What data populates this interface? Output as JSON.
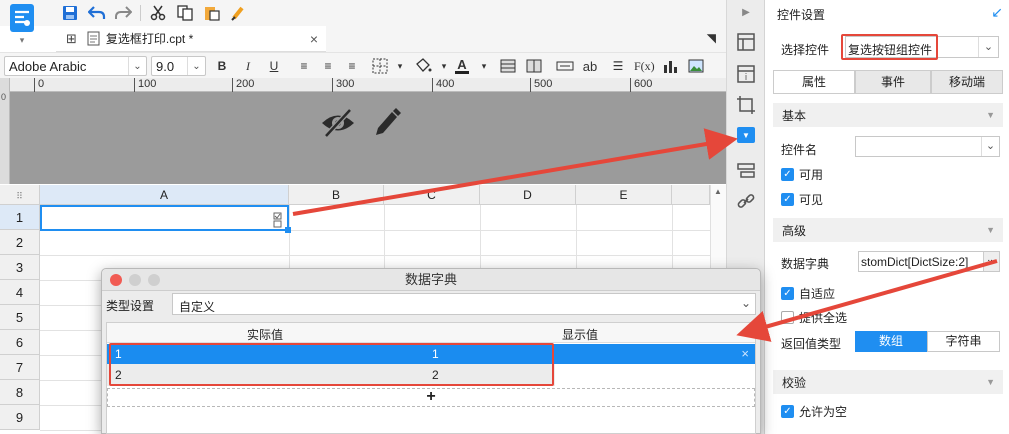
{
  "toolbar": {
    "icons": [
      "save-icon",
      "undo-icon",
      "redo-icon",
      "cut-icon",
      "copy-icon",
      "paste-icon",
      "format-painter-icon"
    ]
  },
  "tab": {
    "label": "复选框打印.cpt *",
    "close": "×"
  },
  "format": {
    "font_name": "Adobe Arabic",
    "font_size": "9.0",
    "bold": "B",
    "italic": "I",
    "underline": "U",
    "text_btn": "ab",
    "formula_btn": "F(x)"
  },
  "ruler": {
    "marks": [
      "0",
      "100",
      "200",
      "300",
      "400",
      "500",
      "600"
    ]
  },
  "grid": {
    "columns": [
      "A",
      "B",
      "C",
      "D",
      "E"
    ],
    "rows": [
      "1",
      "2",
      "3",
      "4",
      "5",
      "6",
      "7",
      "8",
      "9"
    ]
  },
  "panel": {
    "title": "控件设置",
    "select_label": "选择控件",
    "select_value": "复选按钮组控件",
    "tabs": [
      "属性",
      "事件",
      "移动端"
    ],
    "section_basic": "基本",
    "widget_name_label": "控件名",
    "widget_name_value": "",
    "enabled_label": "可用",
    "visible_label": "可见",
    "section_advanced": "高级",
    "dict_label": "数据字典",
    "dict_value": "stomDict[DictSize:2]",
    "dict_more": "...",
    "adaptive_label": "自适应",
    "select_all_label": "提供全选",
    "return_type_label": "返回值类型",
    "return_type_options": [
      "数组",
      "字符串"
    ],
    "section_verify": "校验",
    "allow_empty_label": "允许为空"
  },
  "dialog": {
    "title": "数据字典",
    "type_label": "类型设置",
    "type_value": "自定义",
    "col_actual": "实际值",
    "col_display": "显示值",
    "rows": [
      {
        "actual": "1",
        "display": "1"
      },
      {
        "actual": "2",
        "display": "2"
      }
    ],
    "add": "+",
    "row_close": "×"
  },
  "colors": {
    "accent": "#1f8ef1",
    "selected_row": "#1a8cf0",
    "annotation_red": "#e5473a"
  }
}
